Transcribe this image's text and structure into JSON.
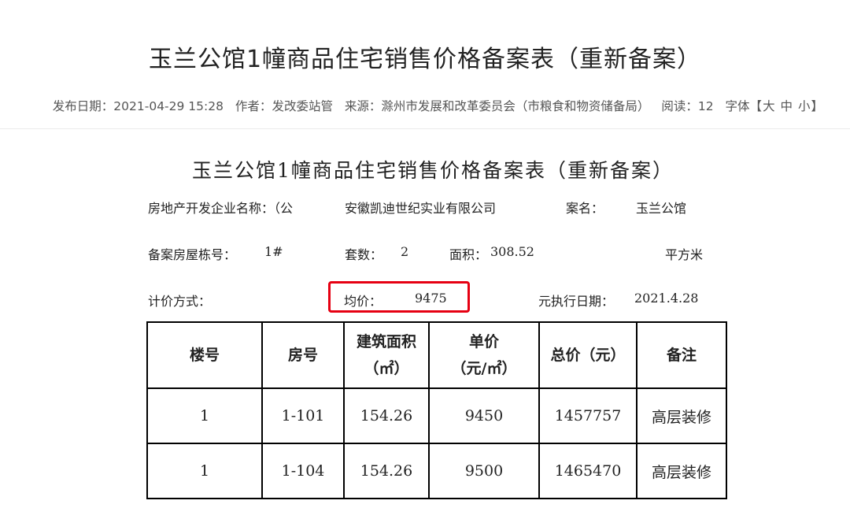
{
  "article": {
    "title": "玉兰公馆1幢商品住宅销售价格备案表（重新备案）",
    "meta": {
      "publish_label": "发布日期：",
      "publish_value": "2021-04-29 15:28",
      "author_label": "作者：",
      "author_value": "发改委站管",
      "source_label": "来源：",
      "source_value": "滁州市发展和改革委员会（市粮食和物资储备局）",
      "views_label": "阅读：",
      "views_value": "12",
      "font_label": "字体【",
      "font_large": "大",
      "font_medium": "中",
      "font_small": "小",
      "font_close": "】"
    }
  },
  "document": {
    "title": "玉兰公馆1幢商品住宅销售价格备案表（重新备案）",
    "developer_label": "房地产开发企业名称：（公",
    "developer_value": "安徽凯迪世纪实业有限公司",
    "case_label": "案名：",
    "case_value": "玉兰公馆",
    "building_label": "备案房屋栋号：",
    "building_value": "1#",
    "units_label": "套数：",
    "units_value": "2",
    "area_label": "面积：",
    "area_value": "308.52",
    "area_unit": "平方米",
    "pricing_label": "计价方式：",
    "avg_label": "均价：",
    "avg_value": "9475",
    "exec_label": "元执行日期：",
    "exec_value": "2021.4.28"
  },
  "table": {
    "headers": [
      {
        "line1": "楼号",
        "line2": ""
      },
      {
        "line1": "房号",
        "line2": ""
      },
      {
        "line1": "建筑面积",
        "line2": "（㎡）"
      },
      {
        "line1": "单价",
        "line2": "（元/㎡）"
      },
      {
        "line1": "总价（元）",
        "line2": ""
      },
      {
        "line1": "备注",
        "line2": ""
      }
    ],
    "rows": [
      [
        "1",
        "1-101",
        "154.26",
        "9450",
        "1457757",
        "高层装修"
      ],
      [
        "1",
        "1-104",
        "154.26",
        "9500",
        "1465470",
        "高层装修"
      ]
    ]
  },
  "colors": {
    "highlight_border": "#e60012"
  }
}
